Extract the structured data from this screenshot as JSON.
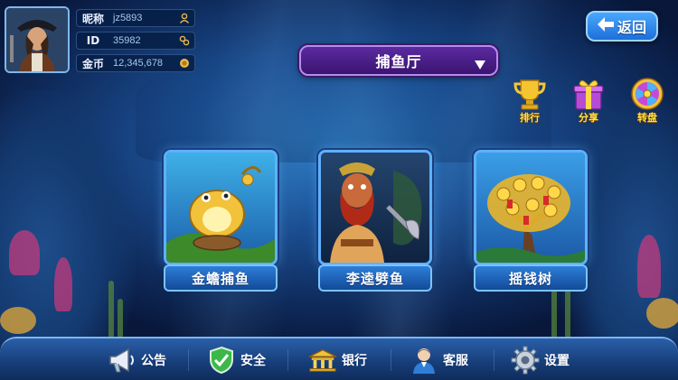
{
  "player": {
    "nickname_label": "昵称",
    "nickname": "jz5893",
    "id_label": "ID",
    "id": "35982",
    "coins_label": "金币",
    "coins": "12,345,678"
  },
  "hall": {
    "title": "捕鱼厅"
  },
  "back_button": {
    "label": "返回"
  },
  "side_icons": [
    {
      "label": "排行",
      "icon": "trophy-icon"
    },
    {
      "label": "分享",
      "icon": "gift-icon"
    },
    {
      "label": "转盘",
      "icon": "wheel-icon"
    }
  ],
  "games": [
    {
      "name": "金蟾捕鱼",
      "art": "golden-toad-art"
    },
    {
      "name": "李逵劈鱼",
      "art": "li-kui-art"
    },
    {
      "name": "摇钱树",
      "art": "money-tree-art"
    }
  ],
  "bottom_bar": [
    {
      "label": "公告",
      "icon": "megaphone-icon"
    },
    {
      "label": "安全",
      "icon": "shield-check-icon"
    },
    {
      "label": "银行",
      "icon": "bank-icon"
    },
    {
      "label": "客服",
      "icon": "customer-service-icon"
    },
    {
      "label": "设置",
      "icon": "gear-icon"
    }
  ],
  "colors": {
    "accent_gold": "#ffe14a",
    "hall_purple": "#5b2aa0",
    "button_blue": "#1e6fd8"
  }
}
